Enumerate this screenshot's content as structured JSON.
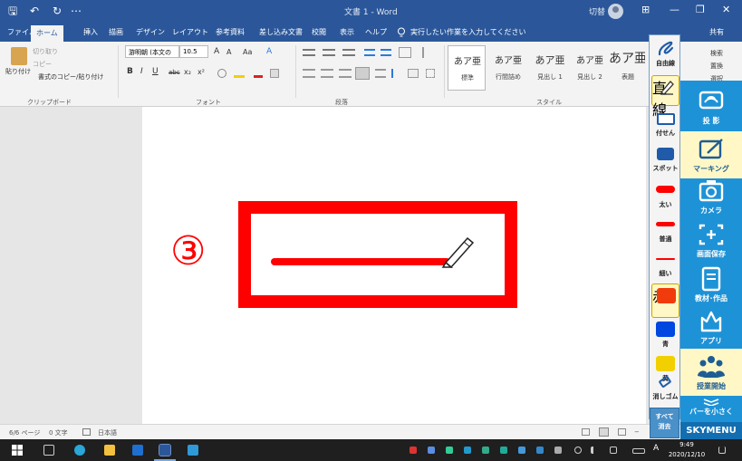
{
  "titlebar": {
    "doc_title": "文書 1 - Word",
    "user_name": "切替",
    "save_glyph": "🖫",
    "undo_glyph": "↶",
    "redo_glyph": "↻",
    "more_glyph": "⋯",
    "win_ribbon": "⊞",
    "win_min": "—",
    "win_restore": "❐",
    "win_close": "✕",
    "accent": "#2b579a"
  },
  "tabs": [
    "ファイル",
    "ホーム",
    "挿入",
    "描画",
    "デザイン",
    "レイアウト",
    "参考資料",
    "差し込み文書",
    "校閲",
    "表示",
    "ヘルプ"
  ],
  "tell_me": "実行したい作業を入力してください",
  "tell_me_icon": "lightbulb-icon",
  "share": "共有",
  "ribbon": {
    "clipboard": {
      "paste": "貼り付け",
      "cut": "切り取り",
      "copy": "コピー",
      "format_painter": "書式のコピー/貼り付け",
      "label": "クリップボード"
    },
    "font": {
      "font_name": "游明朝 (本文の",
      "font_size": "10.5",
      "grow": "A",
      "shrink": "A",
      "case": "Aa",
      "clear": "A",
      "bold": "B",
      "italic": "I",
      "underline": "U",
      "strike": "abc",
      "subscript": "x₂",
      "superscript": "x²",
      "label": "フォント"
    },
    "paragraph": {
      "label": "段落"
    },
    "styles": {
      "items": [
        {
          "sample": "あア亜",
          "name": "標準"
        },
        {
          "sample": "あア亜",
          "name": "行間詰め"
        },
        {
          "sample": "あア亜",
          "name": "見出し 1"
        },
        {
          "sample": "あア亜",
          "name": "見出し 2"
        },
        {
          "sample": "あア亜",
          "name": "表題"
        }
      ],
      "label": "スタイル"
    },
    "editing": {
      "find": "検索",
      "replace": "置換",
      "select": "選択"
    }
  },
  "annotation": {
    "number": "③",
    "color": "#ff0000"
  },
  "statusbar": {
    "page": "6/6 ページ",
    "words": "0 文字",
    "language": "日本語",
    "zoom_minus": "−"
  },
  "taskbar": {
    "ime": "A",
    "time": "9:49",
    "date": "2020/12/10"
  },
  "skymenu_left": {
    "free_line": "自由線",
    "straight_line": "直線",
    "sticky": "付せん",
    "spot": "スポット",
    "thick": "太い",
    "normal": "普通",
    "thin": "細い",
    "red": "赤",
    "blue": "青",
    "yellow": "黄",
    "eraser": "消しゴム",
    "clear_all_1": "すべて",
    "clear_all_2": "消去",
    "colors": {
      "red": "#ff0000",
      "orange_red": "#f23b0c",
      "blue": "#0046e0",
      "yellow": "#f2d000"
    }
  },
  "skymenu_right": {
    "project": "投 影",
    "marking": "マーキング",
    "camera": "カメラ",
    "screen_save": "画面保存",
    "materials": "教材･作品",
    "apps": "アプリ",
    "start_class": "授業開始",
    "shrink_bar": "バーを小さく",
    "logo": "SKYMENU",
    "accent": "#1e92d6"
  }
}
